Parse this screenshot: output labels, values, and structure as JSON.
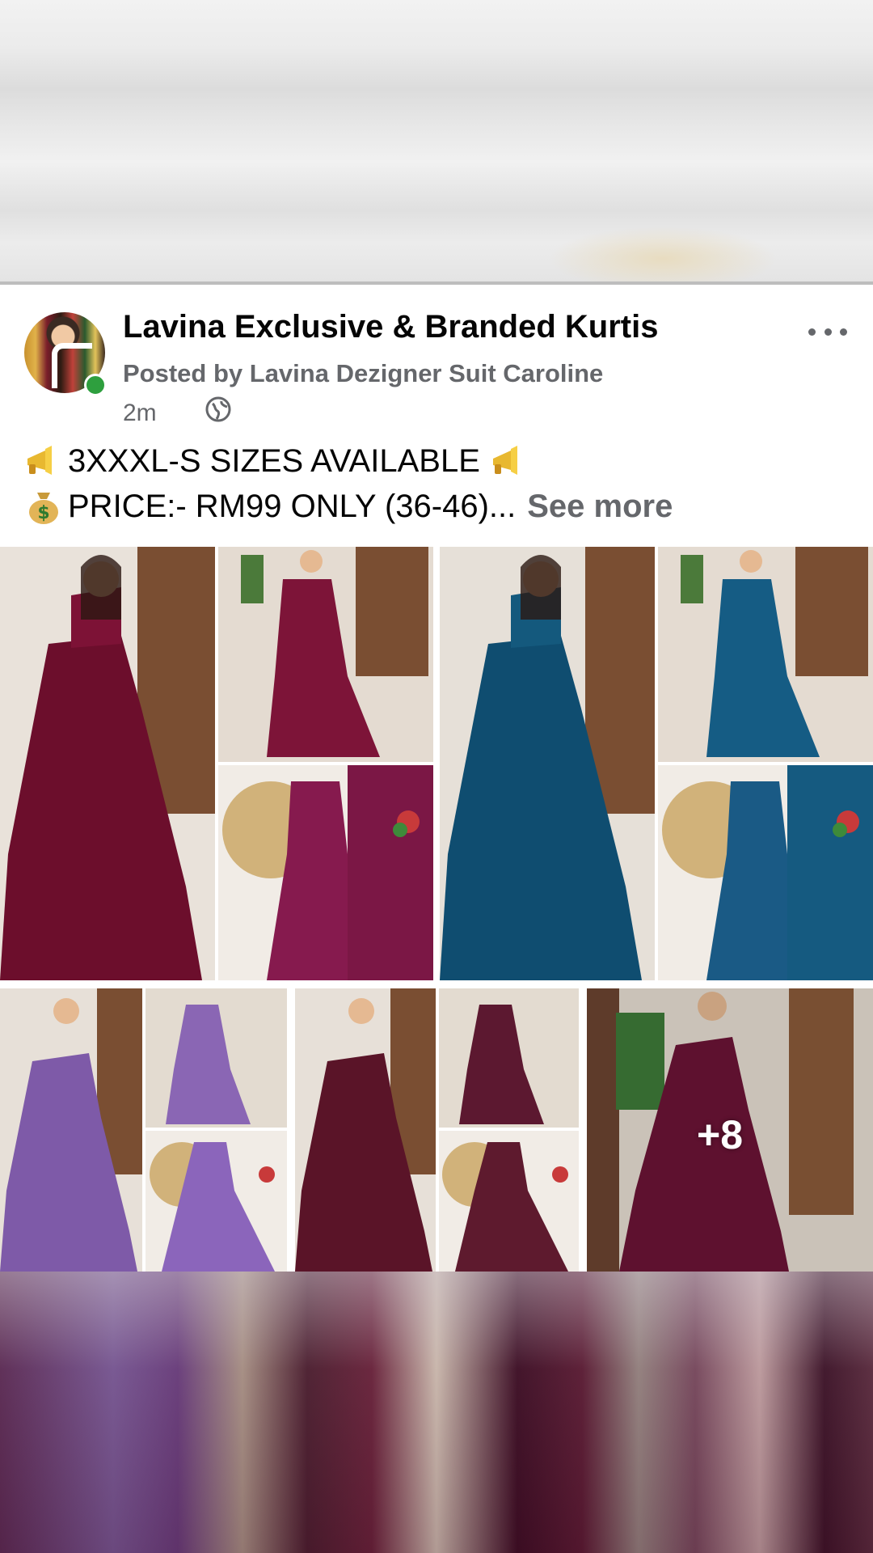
{
  "post": {
    "page_name": "Lavina Exclusive & Branded Kurtis",
    "posted_by": "Posted by Lavina Dezigner Suit Caroline",
    "time": "2m",
    "caption_line1_text": "3XXXL-S SIZES AVAILABLE",
    "caption_line2_text": "PRICE:- RM99 ONLY (36-46)...",
    "see_more": "See more",
    "more_photos_count": "+8"
  },
  "icons": {
    "megaphone": "megaphone-icon",
    "money_bag": "money-bag-icon",
    "globe": "globe-icon",
    "more": "more-options-icon"
  },
  "photos": {
    "gown_colors": [
      "maroon",
      "teal-blue",
      "lavender-purple",
      "wine",
      "wine"
    ]
  },
  "colors": {
    "text_primary": "#050505",
    "text_secondary": "#65676b",
    "online_status": "#2e9f3e"
  }
}
